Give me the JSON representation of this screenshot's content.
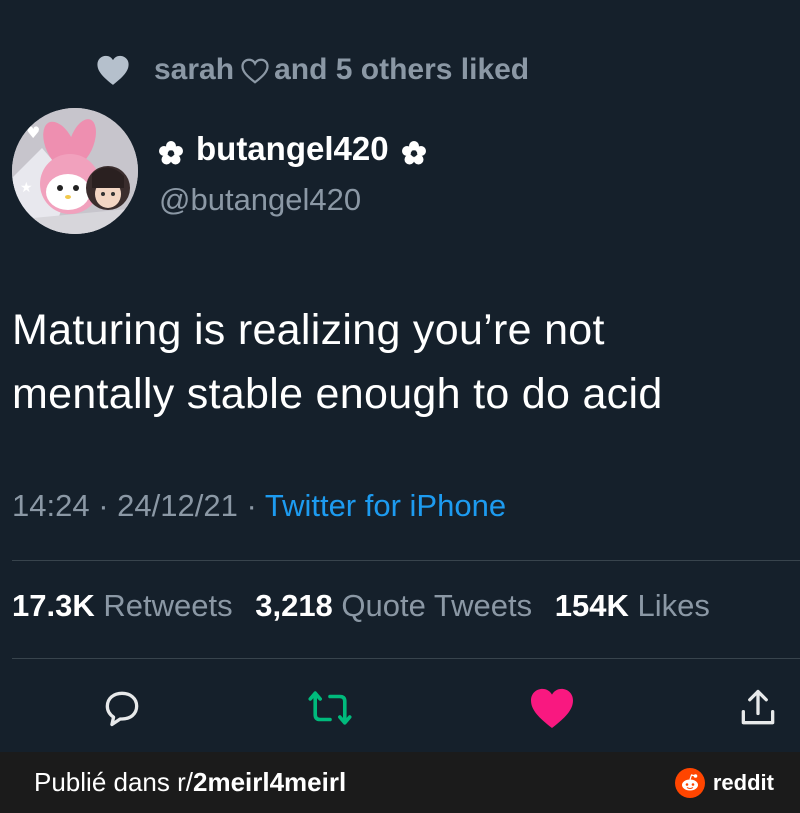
{
  "social_context": {
    "liker_name": "sarah",
    "liked_suffix": "and 5 others liked"
  },
  "author": {
    "display_name": "butangel420",
    "handle": "@butangel420"
  },
  "tweet": {
    "text_line1": "Maturing is realizing you’re not",
    "text_line2": "mentally stable enough to do acid",
    "time": "14:24",
    "date": "24/12/21",
    "separator": "·",
    "source": "Twitter for iPhone"
  },
  "stats": {
    "retweets_count": "17.3K",
    "retweets_label": "Retweets",
    "quotes_count": "3,218",
    "quotes_label": "Quote Tweets",
    "likes_count": "154K",
    "likes_label": "Likes"
  },
  "actions": {
    "reply_icon": "reply-icon",
    "retweet_icon": "retweet-icon",
    "like_icon": "heart-filled-icon",
    "share_icon": "share-icon"
  },
  "footer": {
    "prefix": "Publié dans r/",
    "subreddit": "2meirl4meirl",
    "brand": "reddit"
  },
  "colors": {
    "background": "#15202b",
    "secondary_text": "#8b98a5",
    "link_blue": "#1d9bf0",
    "retweet_green": "#00ba7c",
    "like_pink": "#f91880",
    "footer_bg": "#1b1b1b",
    "reddit_orange": "#ff4500"
  }
}
